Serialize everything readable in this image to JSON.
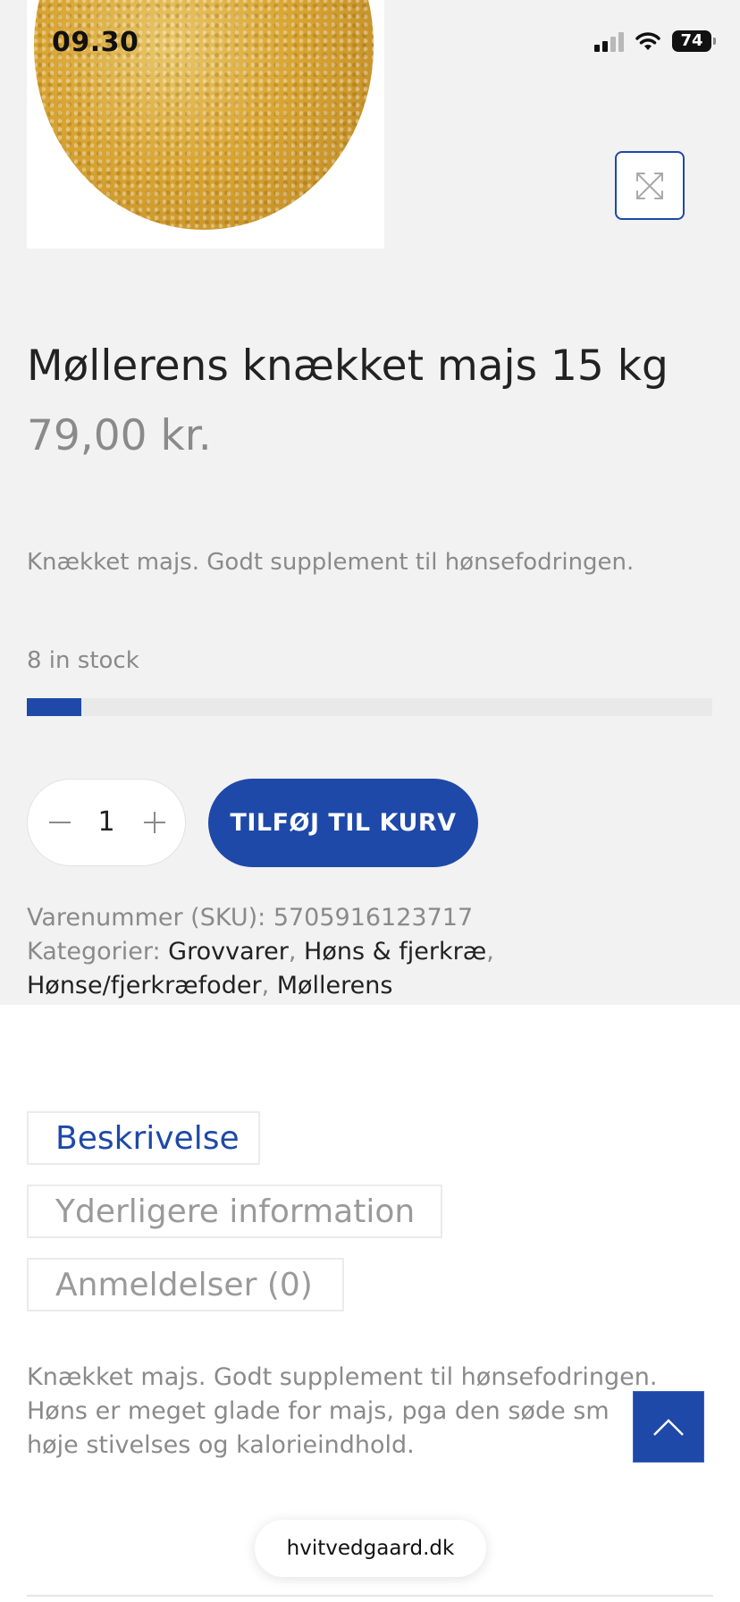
{
  "status_bar": {
    "time": "09.30",
    "battery": "74"
  },
  "product": {
    "title": "Møllerens knækket majs 15 kg",
    "price": "79,00 kr.",
    "short_description": "Knækket majs. Godt supplement til hønsefodringen.",
    "stock_text": "8 in stock",
    "stock_level_fraction": 0.08,
    "quantity": "1",
    "add_to_cart_label": "TILFØJ TIL KURV",
    "sku_label": "Varenummer (SKU):",
    "sku_value": "5705916123717",
    "categories_label": "Kategorier:",
    "categories": [
      "Grovvarer",
      "Høns & fjerkræ",
      "Hønse/fjerkræfoder",
      "Møllerens"
    ]
  },
  "tabs": [
    {
      "label": "Beskrivelse",
      "active": true
    },
    {
      "label": "Yderligere information",
      "active": false
    },
    {
      "label": "Anmeldelser (0)",
      "active": false
    }
  ],
  "description": {
    "lines": [
      "Knækket majs. Godt supplement til hønsefodringen.",
      "Høns er meget glade for majs, pga den søde sm",
      "høje stivelses og kalorieindhold."
    ]
  },
  "browser": {
    "url": "hvitvedgaard.dk"
  },
  "icons": {
    "zoom": "expand-icon",
    "scroll_top": "chevron-up-icon",
    "minus": "minus-icon",
    "plus": "plus-icon"
  },
  "colors": {
    "accent": "#1e49a8",
    "muted_text": "#8a8a8a",
    "section_bg": "#f2f2f3"
  }
}
